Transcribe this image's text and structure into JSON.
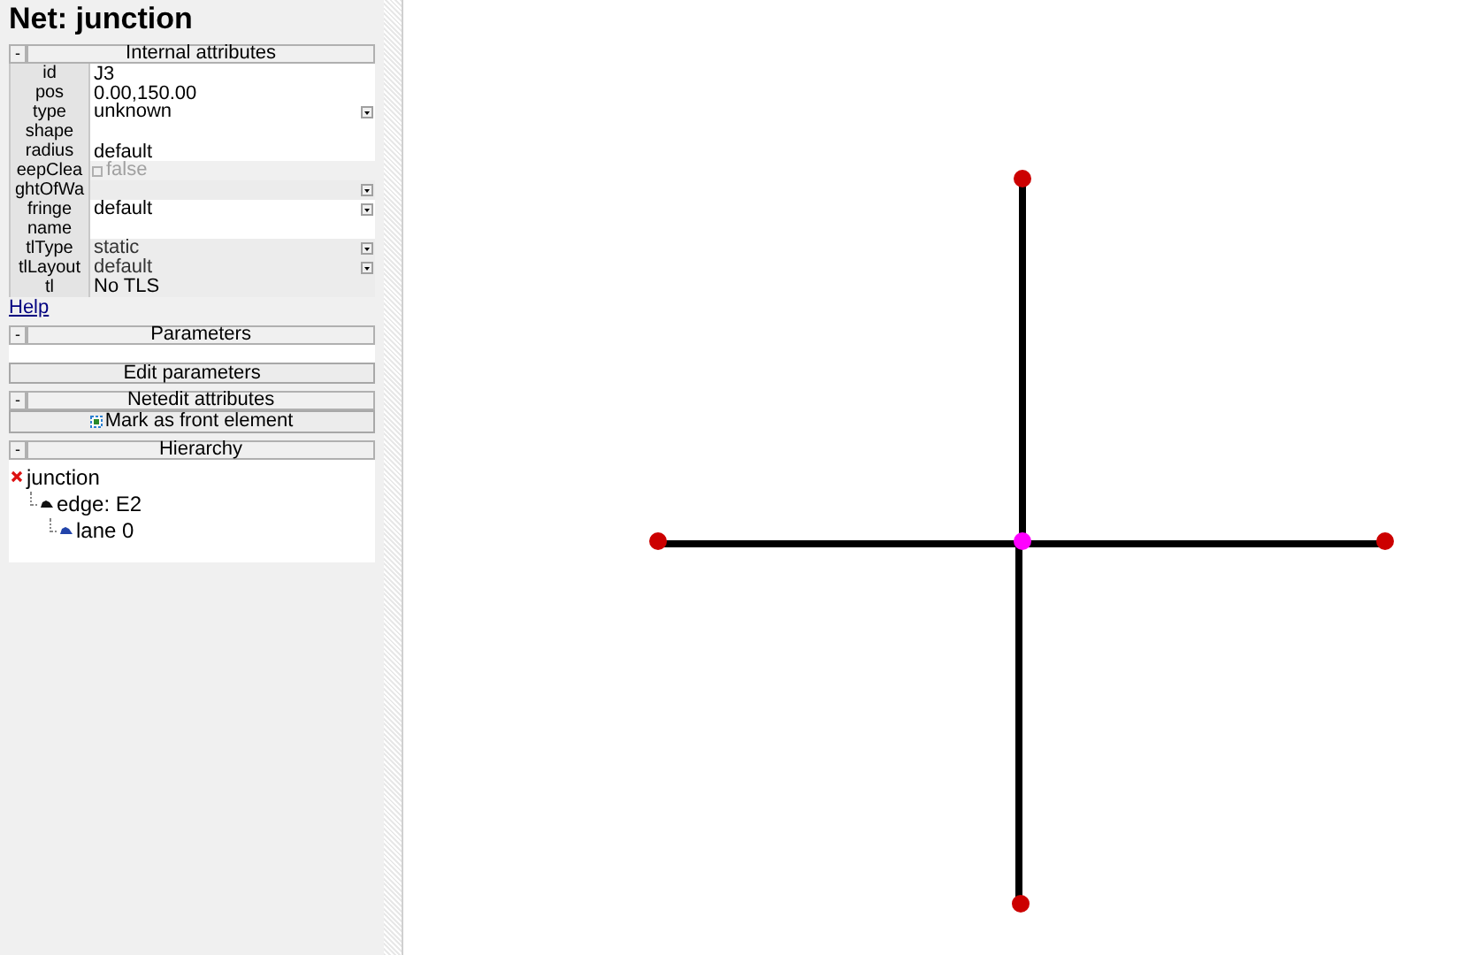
{
  "title": "Net: junction",
  "internal_attributes": {
    "header": "Internal attributes",
    "collapse": "-",
    "rows": [
      {
        "label": "id",
        "kind": "text",
        "value": "J3"
      },
      {
        "label": "pos",
        "kind": "text",
        "value": "0.00,150.00"
      },
      {
        "label": "type",
        "kind": "dropdown",
        "value": "unknown",
        "disabled": false
      },
      {
        "label": "shape",
        "kind": "text",
        "value": ""
      },
      {
        "label": "radius",
        "kind": "text",
        "value": "default"
      },
      {
        "label": "eepClea",
        "kind": "checkbox",
        "value": "false",
        "checked": false,
        "disabled": true
      },
      {
        "label": "ghtOfWa",
        "kind": "dropdown",
        "value": "",
        "disabled": true
      },
      {
        "label": "fringe",
        "kind": "dropdown",
        "value": "default",
        "disabled": false
      },
      {
        "label": "name",
        "kind": "text",
        "value": ""
      },
      {
        "label": "tlType",
        "kind": "dropdown",
        "value": "static",
        "disabled": true
      },
      {
        "label": "tlLayout",
        "kind": "dropdown",
        "value": "default",
        "disabled": true
      },
      {
        "label": "tl",
        "kind": "label",
        "value": "No TLS"
      }
    ]
  },
  "help_link": "Help",
  "parameters": {
    "header": "Parameters",
    "collapse": "-",
    "button": "Edit parameters"
  },
  "netedit_attributes": {
    "header": "Netedit attributes",
    "collapse": "-",
    "button": "Mark as front element"
  },
  "hierarchy": {
    "header": "Hierarchy",
    "collapse": "-",
    "tree": [
      {
        "label": "junction",
        "children": [
          {
            "label": "edge: E2",
            "children": [
              {
                "label": "lane 0"
              }
            ]
          }
        ]
      }
    ]
  },
  "canvas": {
    "junctions": [
      {
        "color": "#cc0000"
      },
      {
        "color": "#cc0000"
      },
      {
        "color": "#cc0000"
      },
      {
        "color": "#cc0000"
      },
      {
        "color": "#ff00ff"
      }
    ]
  }
}
